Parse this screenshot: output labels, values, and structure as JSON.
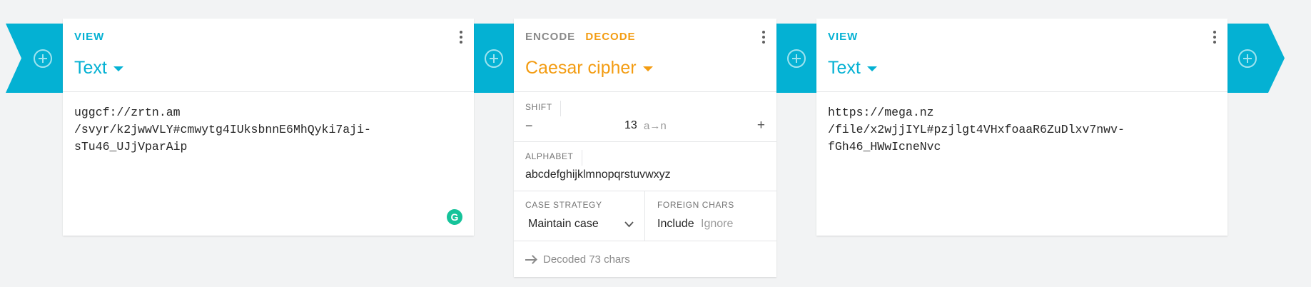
{
  "theme": {
    "accent": "#04b1d3",
    "operation_accent": "#f39c12"
  },
  "left_view": {
    "tag": "VIEW",
    "format": "Text",
    "content": "uggcf://zrtn.am\n/svyr/k2jwwVLY#cmwytg4IUksbnnE6MhQyki7aji-\nsTu46_UJjVparAip",
    "grammarly_badge": "G"
  },
  "operation": {
    "tabs": [
      "ENCODE",
      "DECODE"
    ],
    "active_tab": "DECODE",
    "name": "Caesar cipher",
    "shift": {
      "label": "SHIFT",
      "value": "13",
      "hint": "a→n",
      "decrement": "−",
      "increment": "+"
    },
    "alphabet": {
      "label": "ALPHABET",
      "value": "abcdefghijklmnopqrstuvwxyz"
    },
    "case_strategy": {
      "label": "CASE STRATEGY",
      "value": "Maintain case"
    },
    "foreign_chars": {
      "label": "FOREIGN CHARS",
      "options": [
        "Include",
        "Ignore"
      ],
      "selected": "Include"
    },
    "status": "Decoded 73 chars"
  },
  "right_view": {
    "tag": "VIEW",
    "format": "Text",
    "content": "https://mega.nz\n/file/x2wjjIYL#pzjlgt4VHxfoaaR6ZuDlxv7nwv-\nfGh46_HWwIcneNvc"
  },
  "icons": [
    "add-icon",
    "more-vert-icon",
    "caret-down-icon",
    "minus-icon",
    "plus-icon",
    "chevron-down-icon",
    "arrow-right-icon",
    "grammarly-icon"
  ]
}
